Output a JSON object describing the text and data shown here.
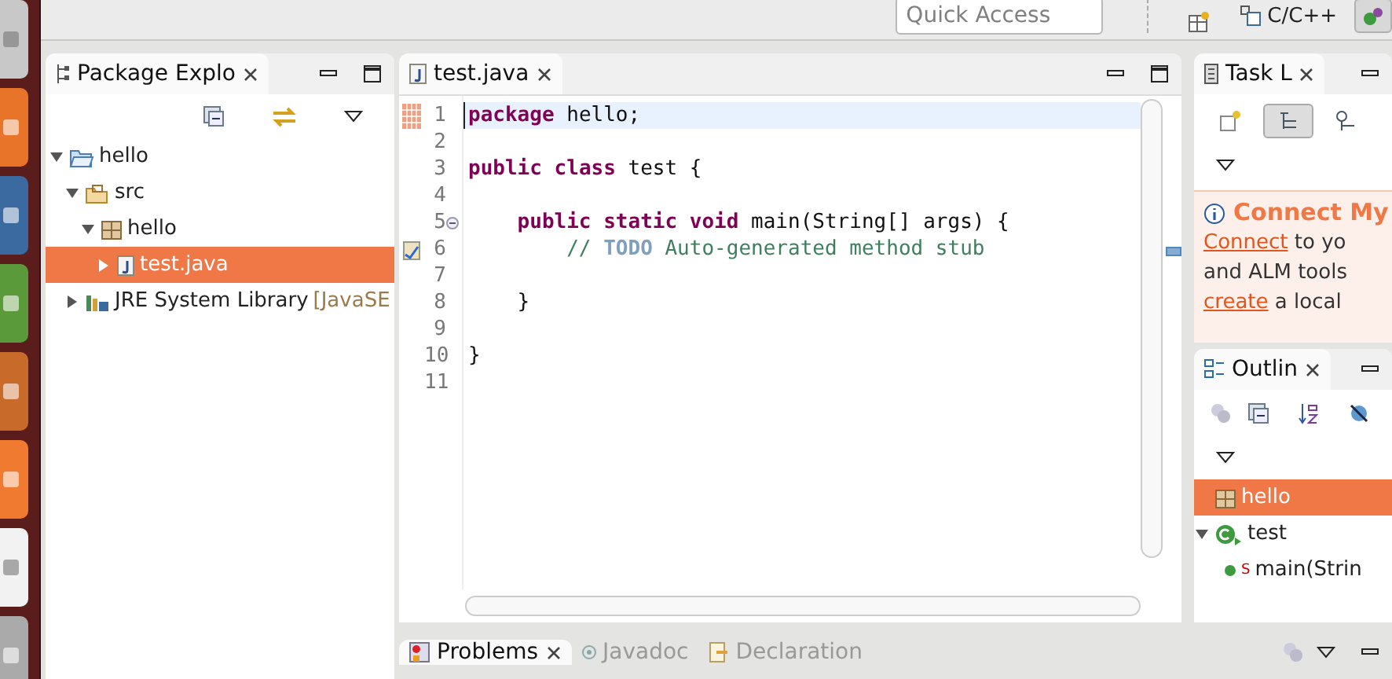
{
  "toolbar": {
    "quick_access": {
      "placeholder": "Quick Access"
    },
    "perspectives": [
      {
        "kind": "labeled",
        "label": "C/C++",
        "selected": false
      },
      {
        "kind": "icon",
        "selected": true
      }
    ]
  },
  "launcher": [
    {
      "kind": "box"
    },
    {
      "kind": "browser"
    },
    {
      "kind": "doc"
    },
    {
      "kind": "sheet"
    },
    {
      "kind": "slides"
    },
    {
      "kind": "store"
    },
    {
      "kind": "bag"
    },
    {
      "kind": "tools"
    }
  ],
  "package_explorer": {
    "title": "Package Explo",
    "tree": [
      {
        "label": "hello",
        "kind": "project",
        "expanded": true,
        "selected": false,
        "children": [
          {
            "label": "src",
            "kind": "folder",
            "expanded": true,
            "selected": false,
            "children": [
              {
                "label": "hello",
                "kind": "package",
                "expanded": true,
                "selected": false,
                "children": [
                  {
                    "label": "test.java",
                    "kind": "java",
                    "expanded": false,
                    "selected": true
                  }
                ]
              }
            ]
          },
          {
            "label": "JRE System Library",
            "decoration": "[JavaSE",
            "kind": "library",
            "expanded": false,
            "selected": false
          }
        ]
      }
    ]
  },
  "editor": {
    "tab": "test.java",
    "lines": [
      {
        "number": "1",
        "current": true,
        "hatch_marker": true,
        "kind": "top",
        "segments": [
          {
            "kind": "keyword",
            "text": "package"
          },
          {
            "kind": "plain",
            "text": " hello;"
          }
        ]
      },
      {
        "number": "2",
        "current": false
      },
      {
        "number": "3",
        "current": false,
        "kind": "top",
        "segments": [
          {
            "kind": "keyword",
            "text": "public class"
          },
          {
            "kind": "plain",
            "text": " test {"
          }
        ]
      },
      {
        "number": "4",
        "current": false
      },
      {
        "number": "5",
        "current": false,
        "fold_open": true,
        "kind": "member",
        "segments": [
          {
            "kind": "keyword",
            "text": "public static void"
          },
          {
            "kind": "plain",
            "text": " main(String[] args) {"
          }
        ]
      },
      {
        "number": "6",
        "current": false,
        "task_marker": true,
        "overview": true,
        "kind": "body",
        "segments": [
          {
            "kind": "comment",
            "text": "// "
          },
          {
            "kind": "todo",
            "text": "TODO"
          },
          {
            "kind": "comment",
            "text": " Auto-generated method stub"
          }
        ]
      },
      {
        "number": "7",
        "current": false
      },
      {
        "number": "8",
        "current": false,
        "kind": "member",
        "segments": [
          {
            "kind": "plain",
            "text": "}"
          }
        ]
      },
      {
        "number": "9",
        "current": false
      },
      {
        "number": "10",
        "current": false,
        "kind": "top",
        "segments": [
          {
            "kind": "plain",
            "text": "}"
          }
        ]
      },
      {
        "number": "11",
        "current": false
      }
    ]
  },
  "task_list": {
    "title": "Task L",
    "connect": {
      "heading": "Connect My",
      "lines": [
        [
          {
            "kind": "link",
            "text": "Connect"
          },
          {
            "kind": "plain",
            "text": " to yo"
          }
        ],
        [
          {
            "kind": "plain",
            "text": "and ALM tools"
          }
        ],
        [
          {
            "kind": "link",
            "text": "create"
          },
          {
            "kind": "plain",
            "text": " a local"
          }
        ]
      ]
    }
  },
  "outline": {
    "title": "Outlin",
    "tree": [
      {
        "label": "hello",
        "kind": "package",
        "selected": true
      },
      {
        "label": "test",
        "kind": "class",
        "selected": false,
        "expanded": true,
        "children": [
          {
            "label": "main(Strin",
            "kind": "method",
            "modifier": "S",
            "selected": false
          }
        ]
      }
    ]
  },
  "bottom_tabs": [
    {
      "label": "Problems",
      "kind": "problems",
      "selected": true
    },
    {
      "label": "Javadoc",
      "kind": "at",
      "selected": false
    },
    {
      "label": "Declaration",
      "kind": "declaration",
      "selected": false
    }
  ]
}
